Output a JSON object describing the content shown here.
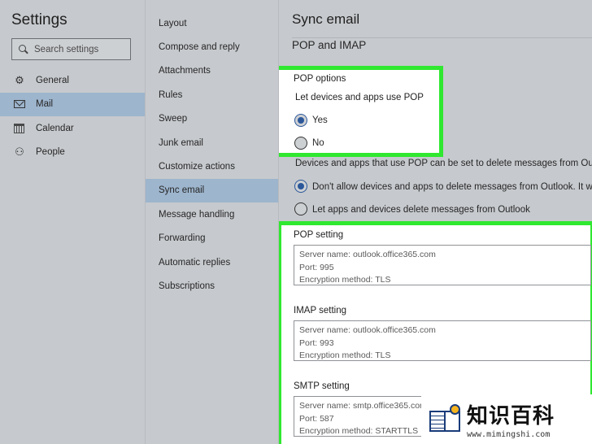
{
  "app": {
    "title": "Settings"
  },
  "search": {
    "placeholder": "Search settings"
  },
  "nav_primary": [
    {
      "label": "General",
      "icon": "gear-icon",
      "active": false
    },
    {
      "label": "Mail",
      "icon": "mail-icon",
      "active": true
    },
    {
      "label": "Calendar",
      "icon": "calendar-icon",
      "active": false
    },
    {
      "label": "People",
      "icon": "people-icon",
      "active": false
    }
  ],
  "nav_secondary": [
    {
      "label": "Layout",
      "active": false
    },
    {
      "label": "Compose and reply",
      "active": false
    },
    {
      "label": "Attachments",
      "active": false
    },
    {
      "label": "Rules",
      "active": false
    },
    {
      "label": "Sweep",
      "active": false
    },
    {
      "label": "Junk email",
      "active": false
    },
    {
      "label": "Customize actions",
      "active": false
    },
    {
      "label": "Sync email",
      "active": true
    },
    {
      "label": "Message handling",
      "active": false
    },
    {
      "label": "Forwarding",
      "active": false
    },
    {
      "label": "Automatic replies",
      "active": false
    },
    {
      "label": "Subscriptions",
      "active": false
    }
  ],
  "main": {
    "title": "Sync email",
    "subtitle": "POP and IMAP",
    "pop_options": {
      "heading": "POP options",
      "question": "Let devices and apps use POP",
      "yes_label": "Yes",
      "no_label": "No",
      "selected": "yes"
    },
    "delete_section": {
      "description": "Devices and apps that use POP can be set to delete messages from Outlook after download.",
      "option_dont_allow": "Don't allow devices and apps to delete messages from Outlook. It will mark the messages as downloaded instead.",
      "option_allow": "Let apps and devices delete messages from Outlook",
      "selected": "dont_allow"
    },
    "pop_setting": {
      "heading": "POP setting",
      "server": "Server name: outlook.office365.com",
      "port": "Port: 995",
      "encryption": "Encryption method: TLS"
    },
    "imap_setting": {
      "heading": "IMAP setting",
      "server": "Server name: outlook.office365.com",
      "port": "Port: 993",
      "encryption": "Encryption method: TLS"
    },
    "smtp_setting": {
      "heading": "SMTP setting",
      "server": "Server name: smtp.office365.com",
      "port": "Port: 587",
      "encryption": "Encryption method: STARTTLS"
    }
  },
  "watermark": {
    "title": "知识百科",
    "url": "www.mimingshi.com"
  },
  "colors": {
    "highlight": "#2fe82f",
    "active_nav": "#9db5cd",
    "accent": "#2b579a",
    "background": "#c6c9cd"
  }
}
